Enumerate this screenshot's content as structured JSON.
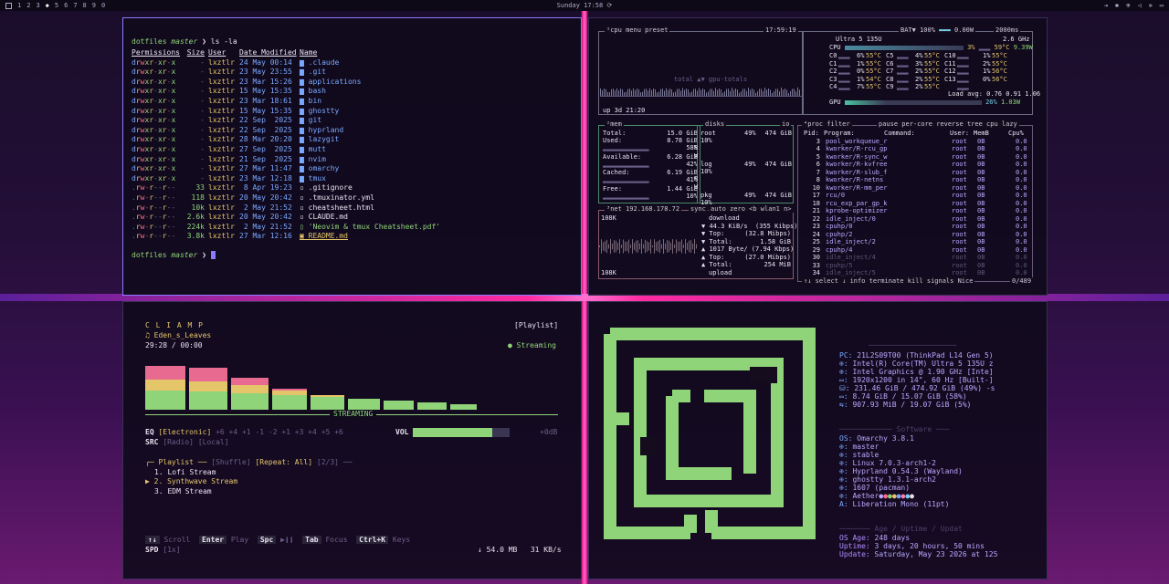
{
  "topbar": {
    "workspaces": [
      "1",
      "2",
      "3",
      "4",
      "5",
      "6",
      "7",
      "8",
      "9",
      "0"
    ],
    "active_workspace": "4",
    "clock": "Sunday 17:58"
  },
  "terminal": {
    "prompt_dir": "dotfiles",
    "prompt_branch": "master",
    "prompt_sym": "❯",
    "command": "ls -la",
    "headers": {
      "perm": "Permissions",
      "size": "Size",
      "user": "User",
      "date": "Date Modified",
      "name": "Name"
    },
    "rows": [
      {
        "perm": "drwxr-xr-x",
        "size": "-",
        "user": "lxztlr",
        "date": "24 May 00:14",
        "name": ".claude",
        "type": "dir"
      },
      {
        "perm": "drwxr-xr-x",
        "size": "-",
        "user": "lxztlr",
        "date": "23 May 23:55",
        "name": ".git",
        "type": "dir"
      },
      {
        "perm": "drwxr-xr-x",
        "size": "-",
        "user": "lxztlr",
        "date": "23 Mar 15:26",
        "name": "applications",
        "type": "dir"
      },
      {
        "perm": "drwxr-xr-x",
        "size": "-",
        "user": "lxztlr",
        "date": "15 May 15:35",
        "name": "bash",
        "type": "dir"
      },
      {
        "perm": "drwxr-xr-x",
        "size": "-",
        "user": "lxztlr",
        "date": "23 Mar 18:61",
        "name": "bin",
        "type": "dir"
      },
      {
        "perm": "drwxr-xr-x",
        "size": "-",
        "user": "lxztlr",
        "date": "15 May 15:35",
        "name": "ghostty",
        "type": "dir"
      },
      {
        "perm": "drwxr-xr-x",
        "size": "-",
        "user": "lxztlr",
        "date": "22 Sep  2025",
        "name": "git",
        "type": "dir"
      },
      {
        "perm": "drwxr-xr-x",
        "size": "-",
        "user": "lxztlr",
        "date": "22 Sep  2025",
        "name": "hyprland",
        "type": "dir"
      },
      {
        "perm": "drwxr-xr-x",
        "size": "-",
        "user": "lxztlr",
        "date": "28 Mar 20:20",
        "name": "lazygit",
        "type": "dir"
      },
      {
        "perm": "drwxr-xr-x",
        "size": "-",
        "user": "lxztlr",
        "date": "27 Sep  2025",
        "name": "mutt",
        "type": "dir"
      },
      {
        "perm": "drwxr-xr-x",
        "size": "-",
        "user": "lxztlr",
        "date": "21 Sep  2025",
        "name": "nvim",
        "type": "dir"
      },
      {
        "perm": "drwxr-xr-x",
        "size": "-",
        "user": "lxztlr",
        "date": "27 Mar 11:47",
        "name": "omarchy",
        "type": "dir"
      },
      {
        "perm": "drwxr-xr-x",
        "size": "-",
        "user": "lxztlr",
        "date": "23 Mar 12:18",
        "name": "tmux",
        "type": "dir"
      },
      {
        "perm": ".rw-r--r--",
        "size": "33",
        "user": "lxztlr",
        "date": " 8 Apr 19:23",
        "name": ".gitignore",
        "type": "file"
      },
      {
        "perm": ".rw-r--r--",
        "size": "118",
        "user": "lxztlr",
        "date": "20 May 20:42",
        "name": ".tmuxinator.yml",
        "type": "file"
      },
      {
        "perm": ".rw-r--r--",
        "size": "10k",
        "user": "lxztlr",
        "date": " 2 May 21:52",
        "name": "cheatsheet.html",
        "type": "file"
      },
      {
        "perm": ".rw-r--r--",
        "size": "2.6k",
        "user": "lxztlr",
        "date": "20 May 20:42",
        "name": "CLAUDE.md",
        "type": "file"
      },
      {
        "perm": ".rw-r--r--",
        "size": "224k",
        "user": "lxztlr",
        "date": " 2 May 21:52",
        "name": "'Neovim & tmux Cheatsheet.pdf'",
        "type": "pdf"
      },
      {
        "perm": ".rw-r--r--",
        "size": "3.8k",
        "user": "lxztlr",
        "date": "27 Mar 12:16",
        "name": "README.md",
        "type": "readme"
      }
    ]
  },
  "btop": {
    "cpu_tabs": "¹cpu  menu  preset",
    "time": "17:59:19",
    "bat": "BAT▼ 100%",
    "bat_rate": "0.00W",
    "interval": "2000ms",
    "cpu_model": "Ultra 5 135U",
    "freq": "2.6 GHz",
    "cpu_total": "3%",
    "cpu_temp": "59°C",
    "cpu_power": "9.39W",
    "cores": [
      [
        "C0",
        "6%",
        "55°C",
        "C5",
        "4%",
        "55°C",
        "C10",
        "1%",
        "55°C"
      ],
      [
        "C1",
        "1%",
        "55°C",
        "C6",
        "3%",
        "55°C",
        "C11",
        "2%",
        "55°C"
      ],
      [
        "C2",
        "0%",
        "55°C",
        "C7",
        "2%",
        "55°C",
        "C12",
        "1%",
        "56°C"
      ],
      [
        "C3",
        "1%",
        "54°C",
        "C8",
        "2%",
        "55°C",
        "C13",
        "0%",
        "56°C"
      ],
      [
        "C4",
        "7%",
        "55°C",
        "C9",
        "2%",
        "55°C",
        "",
        "",
        " "
      ]
    ],
    "load_avg": "Load avg: 0.76 0.91 1.06",
    "gpu_label": "GPU",
    "gpu": "26%",
    "gpu_power": "1.03W",
    "uptime": "up 3d 21:20",
    "graph_label": "total ▲▼ gpu-totals",
    "mem": {
      "title": "²mem",
      "total": "15.0 GiB",
      "used": "8.78 GiB",
      "used_pct": "58%",
      "available": "6.28 GiB",
      "avail_pct": "42%",
      "cached": "6.19 GiB",
      "cached_pct": "41%",
      "free": "1.44 GiB",
      "free_pct": "10%"
    },
    "disks": {
      "title": "disks",
      "root": "474 GiB",
      "root_pct": "49%",
      "root_io": "10%",
      "log": "474 GiB",
      "log_pct": "49%",
      "log_io": "10%",
      "pkg": "474 GiB",
      "pkg_pct": "49%",
      "pkg_io": "10%"
    },
    "net": {
      "title": "³net",
      "ip": "192.168.178.72",
      "sync": "sync",
      "auto": "auto",
      "zero": "zero",
      "iface": "<b wlan1 n>",
      "scale_top": "108K",
      "scale_bot": "108K",
      "download": "download",
      "dl_rate": "44.3 KiB/s  (355 Kibps)",
      "dl_top": "(32.8 Mibps)",
      "dl_total": "1.58 GiB",
      "ul_rate": "1017 Byte/ (7.94 Kbps)",
      "ul_top": "(27.0 Mibps)",
      "ul_total": "254 MiB",
      "upload": "upload"
    },
    "proc": {
      "title": "⁴proc",
      "filter": "filter",
      "pause": "pause",
      "per_core": "per-core",
      "reverse": "reverse",
      "tree": "tree",
      "sort": "cpu lazy",
      "headers": [
        "Pid:",
        "Program:",
        "Command:",
        "User:",
        "MemB",
        "Cpu%"
      ],
      "rows": [
        [
          "3",
          "pool_workqueue_r",
          "root",
          "0B",
          "0.0"
        ],
        [
          "4",
          "kworker/R-rcu_gp",
          "root",
          "0B",
          "0.0"
        ],
        [
          "5",
          "kworker/R-sync_w",
          "root",
          "0B",
          "0.0"
        ],
        [
          "6",
          "kworker/R-kvfree",
          "root",
          "0B",
          "0.0"
        ],
        [
          "7",
          "kworker/R-slub_f",
          "root",
          "0B",
          "0.0"
        ],
        [
          "8",
          "kworker/R-netns",
          "root",
          "0B",
          "0.0"
        ],
        [
          "10",
          "kworker/R-mm_per",
          "root",
          "0B",
          "0.0"
        ],
        [
          "17",
          "rcu/0",
          "root",
          "0B",
          "0.0"
        ],
        [
          "18",
          "rcu_exp_par_gp_k",
          "root",
          "0B",
          "0.0"
        ],
        [
          "21",
          "kprobe-optimizer",
          "root",
          "0B",
          "0.0"
        ],
        [
          "22",
          "idle_inject/0",
          "root",
          "0B",
          "0.0"
        ],
        [
          "23",
          "cpuhp/0",
          "root",
          "0B",
          "0.0"
        ],
        [
          "24",
          "cpuhp/2",
          "root",
          "0B",
          "0.0"
        ],
        [
          "25",
          "idle_inject/2",
          "root",
          "0B",
          "0.0"
        ],
        [
          "29",
          "cpuhp/4",
          "root",
          "0B",
          "0.0"
        ],
        [
          "30",
          "idle_inject/4",
          "root",
          "0B",
          "0.0"
        ],
        [
          "33",
          "cpuhp/5",
          "root",
          "0B",
          "0.0"
        ],
        [
          "34",
          "idle_inject/5",
          "root",
          "0B",
          "0.0"
        ]
      ],
      "footer": "↑↓ select ↓  info  terminate  kill  signals  Nice",
      "count": "0/489"
    }
  },
  "cliamp": {
    "title": "C L I A M P",
    "track": "♫ Eden_s_Leaves",
    "time": "29:28 / 00:00",
    "playlist_tag": "[Playlist]",
    "status": "Streaming",
    "streaming_label": "STREAMING",
    "eq_label": "EQ",
    "eq_preset": "[Electronic]",
    "eq_values": "+6 +4 +1 -1 -2 +1 +3 +4 +5 +6",
    "src_label": "SRC",
    "src_radio": "[Radio]",
    "src_local": "[Local]",
    "vol_label": "VOL",
    "vol_value": "+0dB",
    "vol_level": 0.82,
    "playlist_header": "╭─ Playlist ──",
    "shuffle": "[Shuffle]",
    "repeat": "[Repeat: All]",
    "count": "[2/3]",
    "items": [
      "1. Lofi Stream",
      "2. Synthwave Stream",
      "3. EDM Stream"
    ],
    "keys": [
      {
        "k": "↑↓",
        "a": "Scroll"
      },
      {
        "k": "Enter",
        "a": "Play"
      },
      {
        "k": "Spc",
        "a": "▶❙❙"
      },
      {
        "k": "Tab",
        "a": "Focus"
      },
      {
        "k": "Ctrl+K",
        "a": "Keys"
      }
    ],
    "spd_label": "SPD",
    "spd": "[1x]",
    "download": "↓ 54.0 MB",
    "rate": "31 KB/s",
    "bars": [
      [
        0.55,
        0.3,
        0.15
      ],
      [
        0.52,
        0.28,
        0.15
      ],
      [
        0.48,
        0.22,
        0.08
      ],
      [
        0.42,
        0.12,
        0.02
      ],
      [
        0.37,
        0.05,
        0
      ],
      [
        0.32,
        0,
        0
      ],
      [
        0.26,
        0,
        0
      ],
      [
        0.22,
        0,
        0
      ],
      [
        0.16,
        0,
        0
      ]
    ]
  },
  "fetch": {
    "hw": [
      [
        "PC:",
        "21L2S09T00 (ThinkPad L14 Gen 5)"
      ],
      [
        "⊕:",
        "Intel(R) Core(TM) Ultra 5 135U z"
      ],
      [
        "⊕:",
        "Intel Graphics @ 1.90 GHz [Inte]"
      ],
      [
        "▭:",
        "1920x1200 in 14\", 60 Hz [Built-]"
      ],
      [
        "⛁:",
        "231.46 GiB / 474.92 GiB (49%) -s"
      ],
      [
        "▭:",
        "8.74 GiB / 15.07 GiB (58%)"
      ],
      [
        "⇆:",
        "907.93 MiB / 19.07 GiB (5%)"
      ]
    ],
    "software_label": "Software",
    "sw": [
      [
        "OS:",
        "Omarchy 3.8.1"
      ],
      [
        "⊕:",
        "master"
      ],
      [
        "⊕:",
        "stable"
      ],
      [
        "⊕:",
        "Linux 7.0.3-arch1-2"
      ],
      [
        "⊕:",
        "Hyprland 0.54.3 (Wayland)"
      ],
      [
        "⊕:",
        "ghostty 1.3.1-arch2"
      ],
      [
        "⊕:",
        "1607 (pacman)"
      ],
      [
        "⊕:",
        "Aether"
      ],
      [
        "A:",
        "Liberation Mono (11pt)"
      ]
    ],
    "age_label": "Age / Uptime / Updat",
    "age": [
      [
        "OS Age:",
        "248 days"
      ],
      [
        "Uptime:",
        "3 days, 20 hours, 50 mins"
      ],
      [
        "Update:",
        "Saturday, May 23 2026 at 125"
      ]
    ],
    "colors": [
      "#b8a9ff",
      "#ff6a8a",
      "#8fd479",
      "#e5c56a",
      "#7aa8ff",
      "#ff7ab8",
      "#76d0e8",
      "#e8e2f0"
    ]
  }
}
